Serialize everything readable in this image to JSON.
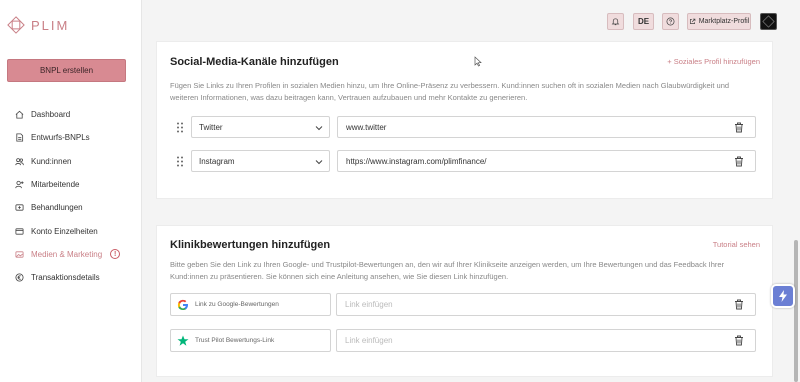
{
  "app": {
    "logo_text": "PLIM",
    "brand_color": "#c97f86"
  },
  "sidebar": {
    "create_button": "BNPL erstellen",
    "items": [
      {
        "label": "Dashboard",
        "icon": "home-icon"
      },
      {
        "label": "Entwurfs-BNPLs",
        "icon": "document-icon"
      },
      {
        "label": "Kund:innen",
        "icon": "users-icon"
      },
      {
        "label": "Mitarbeitende",
        "icon": "user-add-icon"
      },
      {
        "label": "Behandlungen",
        "icon": "treatment-icon"
      },
      {
        "label": "Konto Einzelheiten",
        "icon": "card-icon"
      },
      {
        "label": "Medien & Marketing",
        "icon": "media-icon",
        "active": true,
        "alert": "!"
      },
      {
        "label": "Transaktionsdetails",
        "icon": "euro-icon"
      }
    ]
  },
  "topbar": {
    "language": "DE",
    "marketplace_label": "Marktplatz-Profil"
  },
  "social": {
    "title": "Social-Media-Kanäle hinzufügen",
    "add_link": "+ Soziales Profil hinzufügen",
    "description": "Fügen Sie Links zu Ihren Profilen in sozialen Medien hinzu, um Ihre Online-Präsenz zu verbessern. Kund:innen suchen oft in sozialen Medien nach Glaubwürdigkeit und weiteren Informationen, was dazu beitragen kann, Vertrauen aufzubauen und mehr Kontakte zu generieren.",
    "rows": [
      {
        "platform": "Twitter",
        "url": "www.twitter"
      },
      {
        "platform": "Instagram",
        "url": "https://www.instagram.com/plimfinance/"
      }
    ]
  },
  "reviews": {
    "title": "Klinikbewertungen hinzufügen",
    "tutorial_link": "Tutorial sehen",
    "description": "Bitte geben Sie den Link zu Ihren Google- und Trustpilot-Bewertungen an, den wir auf Ihrer Klinikseite anzeigen werden, um Ihre Bewertungen und das Feedback Ihrer Kund:innen zu präsentieren. Sie können sich eine Anleitung ansehen, wie Sie diesen Link hinzufügen.",
    "rows": [
      {
        "label": "Link zu Google-Bewertungen",
        "placeholder": "Link einfügen",
        "icon": "google-icon"
      },
      {
        "label": "Trust Pilot Bewertungs-Link",
        "placeholder": "Link einfügen",
        "icon": "trustpilot-star-icon"
      }
    ]
  }
}
